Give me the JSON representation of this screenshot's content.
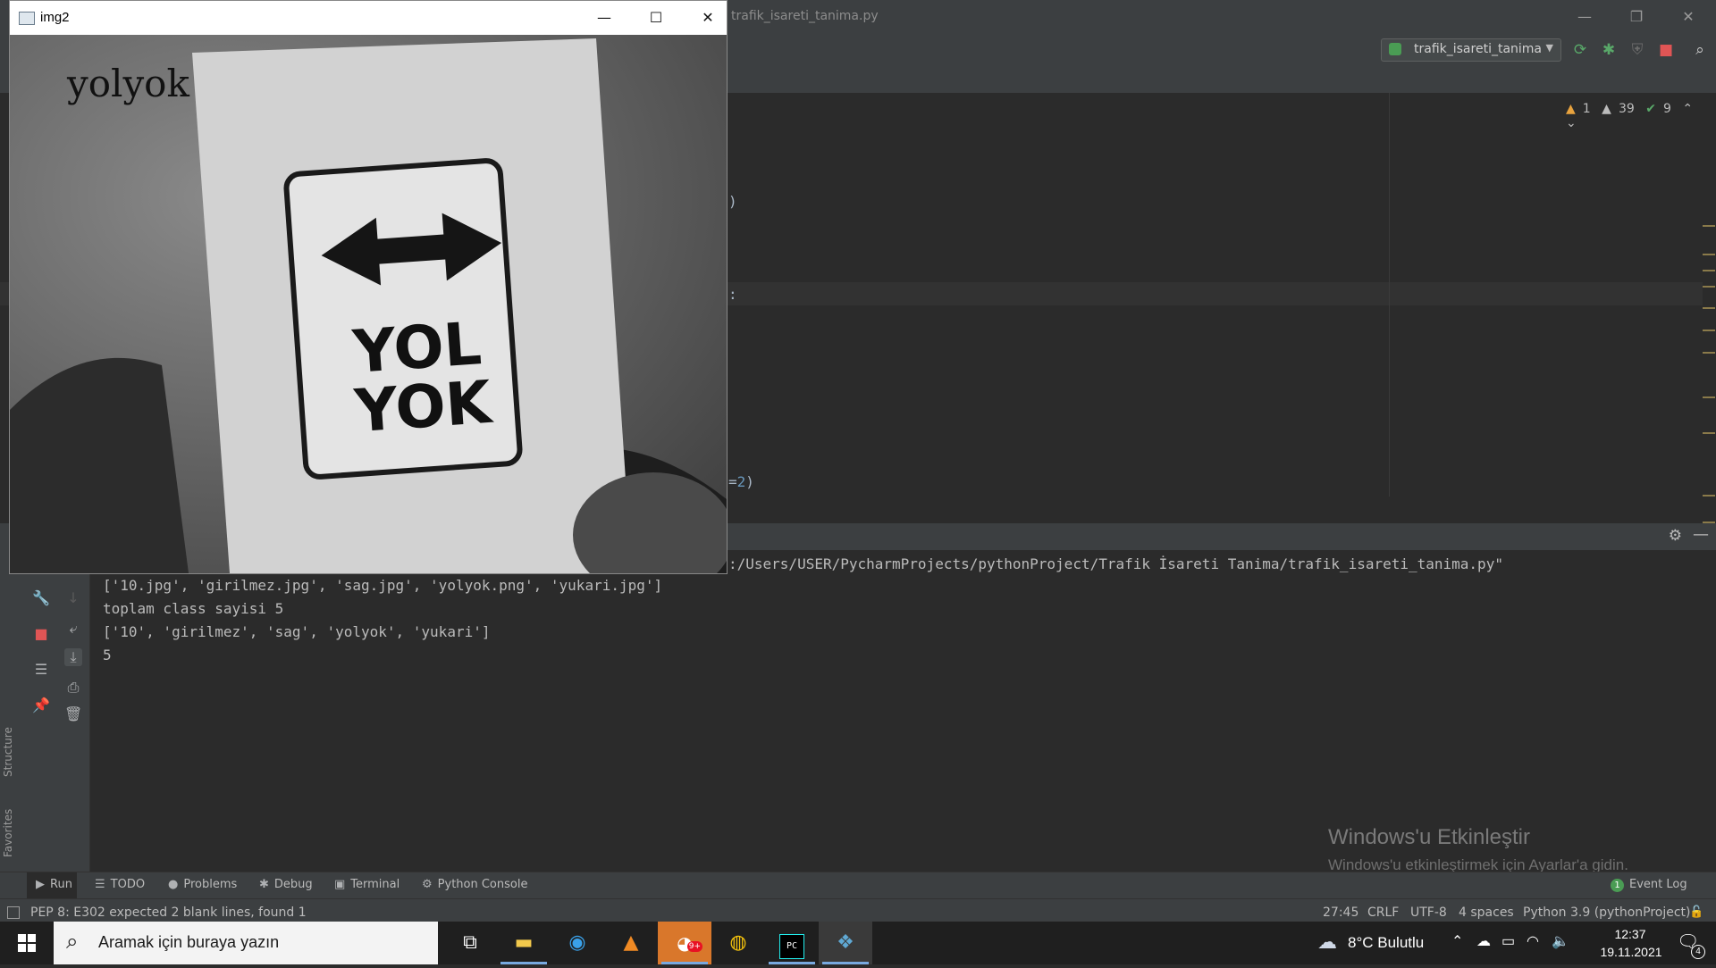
{
  "ide": {
    "file_title": "trafik_isareti_tanima.py",
    "run_config": "trafik_isareti_tanima",
    "inspections": {
      "errors": "1",
      "warnings": "39",
      "typos": "9"
    },
    "visible_code": {
      "frag1": ")",
      "frag2": ":",
      "frag3_prefix": "=",
      "frag3_num": "2",
      "frag3_suffix": ")"
    }
  },
  "run_window": {
    "command": ":/Users/USER/PycharmProjects/pythonProject/Trafik İsareti Tanima/trafik_isareti_tanima.py\"",
    "output_lines": [
      "['10.jpg', 'girilmez.jpg', 'sag.jpg', 'yolyok.png', 'yukari.jpg']",
      "toplam class sayisi 5",
      "['10', 'girilmez', 'sag', 'yolyok', 'yukari']",
      "5"
    ]
  },
  "side_labels": {
    "structure": "Structure",
    "favorites": "Favorites"
  },
  "tool_tabs": [
    {
      "label": "Run",
      "icon": "run-icon"
    },
    {
      "label": "TODO",
      "icon": "todo-icon"
    },
    {
      "label": "Problems",
      "icon": "problems-icon"
    },
    {
      "label": "Debug",
      "icon": "debug-icon"
    },
    {
      "label": "Terminal",
      "icon": "terminal-icon"
    },
    {
      "label": "Python Console",
      "icon": "python-console-icon"
    }
  ],
  "event_log": {
    "count": "1",
    "label": "Event Log"
  },
  "status_bar": {
    "message": "PEP 8: E302 expected 2 blank lines, found 1",
    "position": "27:45",
    "line_sep": "CRLF",
    "encoding": "UTF-8",
    "indent": "4 spaces",
    "interpreter": "Python 3.9 (pythonProject)"
  },
  "watermark": {
    "title": "Windows'u Etkinleştir",
    "subtitle": "Windows'u etkinleştirmek için Ayarlar'a gidin."
  },
  "cv_window": {
    "title": "img2",
    "overlay_label": "yolyok",
    "sign_line1": "YOL",
    "sign_line2": "YOK"
  },
  "taskbar": {
    "search_placeholder": "Aramak için buraya yazın",
    "weather": "8°C  Bulutlu",
    "time": "12:37",
    "date": "19.11.2021",
    "notifications": "4",
    "discord_badge": "9+",
    "pycharm_label": "PC"
  },
  "colors": {
    "accent": "#78a9e0",
    "ide_bg": "#2b2b2b",
    "ide_panel": "#3c3f41",
    "run_green": "#4a9c54",
    "stop_red": "#e05555"
  }
}
